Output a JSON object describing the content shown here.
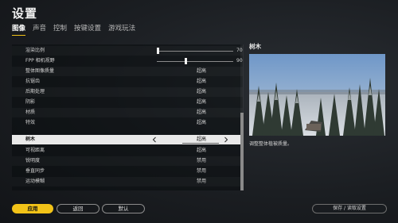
{
  "page": {
    "title": "设置"
  },
  "tabs": [
    {
      "label": "图像",
      "active": true
    },
    {
      "label": "声音",
      "active": false
    },
    {
      "label": "控制",
      "active": false
    },
    {
      "label": "按键设置",
      "active": false
    },
    {
      "label": "游戏玩法",
      "active": false
    }
  ],
  "settings": {
    "rows": [
      {
        "label": "渲染比例",
        "type": "slider",
        "value": "70",
        "fraction": 0.0
      },
      {
        "label": "FPP 相机视野",
        "type": "slider",
        "value": "90",
        "fraction": 0.44
      },
      {
        "label": "整体图像质量",
        "type": "option",
        "value": "超高"
      },
      {
        "label": "抗锯齿",
        "type": "option",
        "value": "超高"
      },
      {
        "label": "后期处理",
        "type": "option",
        "value": "超高"
      },
      {
        "label": "阴影",
        "type": "option",
        "value": "超高"
      },
      {
        "label": "材质",
        "type": "option",
        "value": "超高"
      },
      {
        "label": "特效",
        "type": "option",
        "value": "超高"
      },
      {
        "label": "树木",
        "type": "option",
        "value": "超高",
        "selected": true
      },
      {
        "label": "可视距离",
        "type": "option",
        "value": "超高"
      },
      {
        "label": "锐明度",
        "type": "option",
        "value": "禁用"
      },
      {
        "label": "垂直同步",
        "type": "option",
        "value": "禁用"
      },
      {
        "label": "运动模糊",
        "type": "option",
        "value": "禁用"
      }
    ]
  },
  "info": {
    "title": "树木",
    "description": "调整整体植被质量。"
  },
  "buttons": {
    "apply": "应用",
    "back": "返回",
    "default": "默认",
    "save": "保存 / 读取设置"
  },
  "colors": {
    "accent": "#f2c318"
  },
  "icons": {
    "prev": "chevron-left-icon",
    "next": "chevron-right-icon"
  }
}
